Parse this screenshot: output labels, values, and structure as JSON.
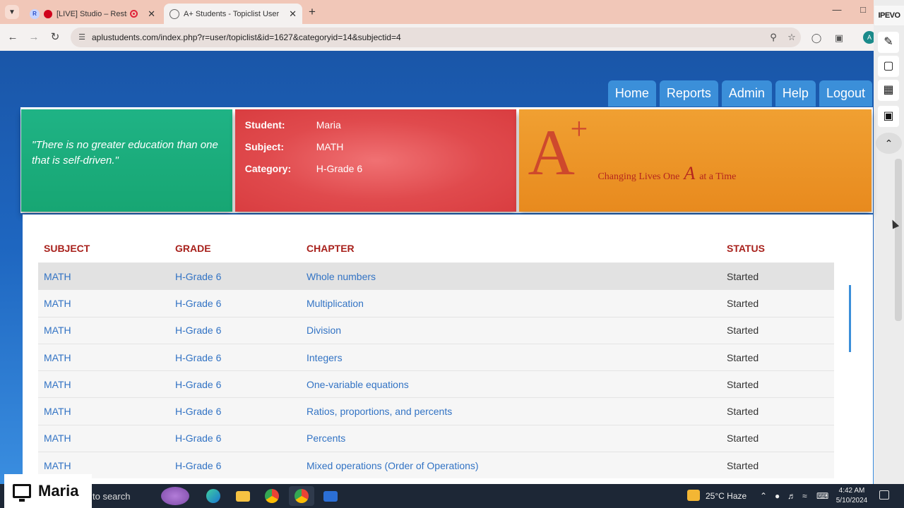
{
  "browser": {
    "tabs": [
      {
        "label": "[LIVE] Studio – Restream",
        "favicon": "R"
      },
      {
        "label": "A+ Students - Topiclist User"
      }
    ],
    "url": "aplustudents.com/index.php?r=user/topiclist&id=1627&categoryid=14&subjectid=4",
    "profile_initial": "A"
  },
  "ipevo": {
    "logo": "IPEVO"
  },
  "nav": {
    "items": [
      "Home",
      "Reports",
      "Admin",
      "Help",
      "Logout"
    ]
  },
  "header": {
    "quote": "\"There is no greater education than one that is self-driven.\"",
    "student_label": "Student:",
    "student_value": "Maria",
    "subject_label": "Subject:",
    "subject_value": "MATH",
    "category_label": "Category:",
    "category_value": "H-Grade 6",
    "logo_a": "A",
    "logo_plus": "+",
    "tagline_pre": "Changing Lives One",
    "tagline_a": "A",
    "tagline_post": "at a Time"
  },
  "table": {
    "columns": [
      "SUBJECT",
      "GRADE",
      "CHAPTER",
      "STATUS"
    ],
    "rows": [
      {
        "subject": "MATH",
        "grade": "H-Grade 6",
        "chapter": "Whole numbers",
        "status": "Started"
      },
      {
        "subject": "MATH",
        "grade": "H-Grade 6",
        "chapter": "Multiplication",
        "status": "Started"
      },
      {
        "subject": "MATH",
        "grade": "H-Grade 6",
        "chapter": "Division",
        "status": "Started"
      },
      {
        "subject": "MATH",
        "grade": "H-Grade 6",
        "chapter": "Integers",
        "status": "Started"
      },
      {
        "subject": "MATH",
        "grade": "H-Grade 6",
        "chapter": "One-variable equations",
        "status": "Started"
      },
      {
        "subject": "MATH",
        "grade": "H-Grade 6",
        "chapter": "Ratios, proportions, and percents",
        "status": "Started"
      },
      {
        "subject": "MATH",
        "grade": "H-Grade 6",
        "chapter": "Percents",
        "status": "Started"
      },
      {
        "subject": "MATH",
        "grade": "H-Grade 6",
        "chapter": "Mixed operations (Order of Operations)",
        "status": "Started"
      }
    ]
  },
  "taskbar": {
    "user_name": "Maria",
    "search_text": "to search",
    "weather": "25°C  Haze",
    "time": "4:42 AM",
    "date": "5/10/2024"
  },
  "colors": {
    "site_blue": "#1a56a8",
    "nav_tab": "#3b8fd9",
    "panel_green": "#17a673",
    "panel_red": "#e04a4d",
    "panel_orange": "#e88a1e",
    "header_text_red": "#a8211c",
    "link_blue": "#3273c4"
  }
}
